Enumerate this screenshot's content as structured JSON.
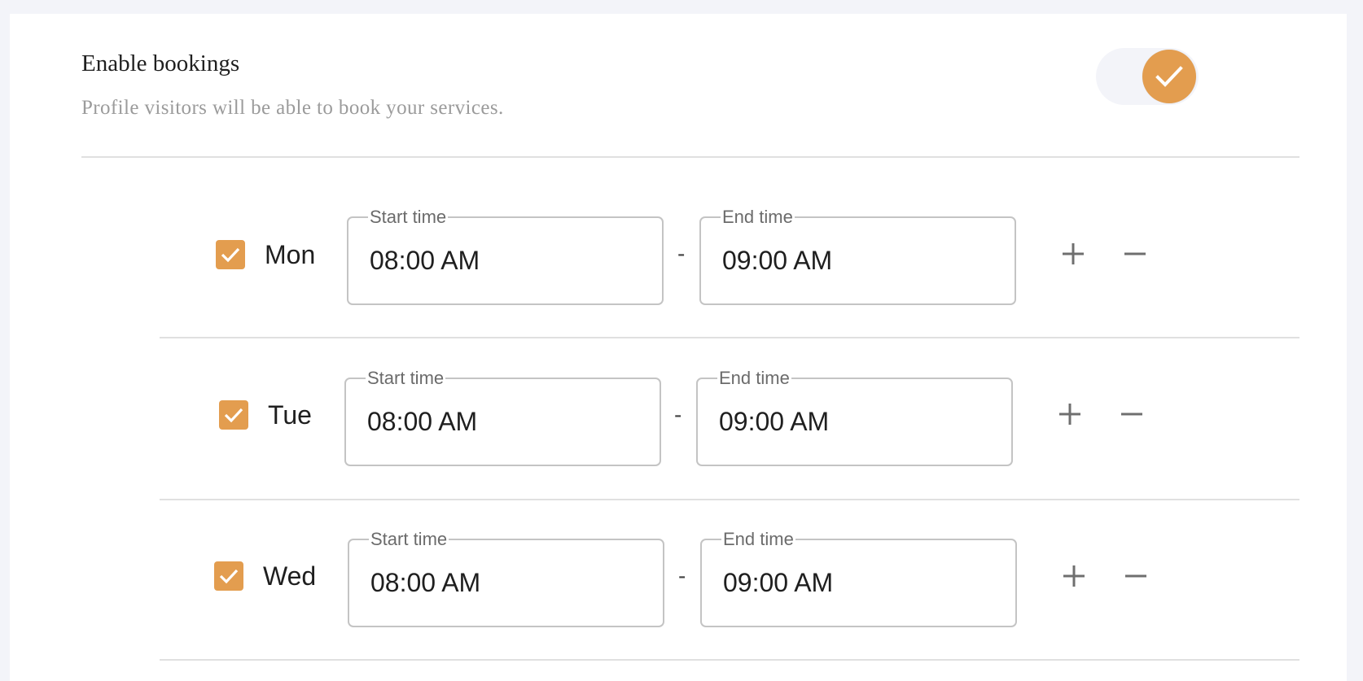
{
  "header": {
    "title": "Enable bookings",
    "subtitle": "Profile visitors will be able to book your services."
  },
  "toggle": {
    "enabled": true,
    "icon": "check-icon"
  },
  "colors": {
    "accent": "#e39d4f",
    "background": "#f3f4f9",
    "divider": "#e0e0e0"
  },
  "schedule": [
    {
      "day": "Mon",
      "checked": true,
      "start_label": "Start time",
      "start_value": "08:00 AM",
      "separator": "-",
      "end_label": "End time",
      "end_value": "09:00 AM",
      "add_icon": "plus-icon",
      "remove_icon": "minus-icon"
    },
    {
      "day": "Tue",
      "checked": true,
      "start_label": "Start time",
      "start_value": "08:00 AM",
      "separator": "-",
      "end_label": "End time",
      "end_value": "09:00 AM",
      "add_icon": "plus-icon",
      "remove_icon": "minus-icon"
    },
    {
      "day": "Wed",
      "checked": true,
      "start_label": "Start time",
      "start_value": "08:00 AM",
      "separator": "-",
      "end_label": "End time",
      "end_value": "09:00 AM",
      "add_icon": "plus-icon",
      "remove_icon": "minus-icon"
    }
  ]
}
